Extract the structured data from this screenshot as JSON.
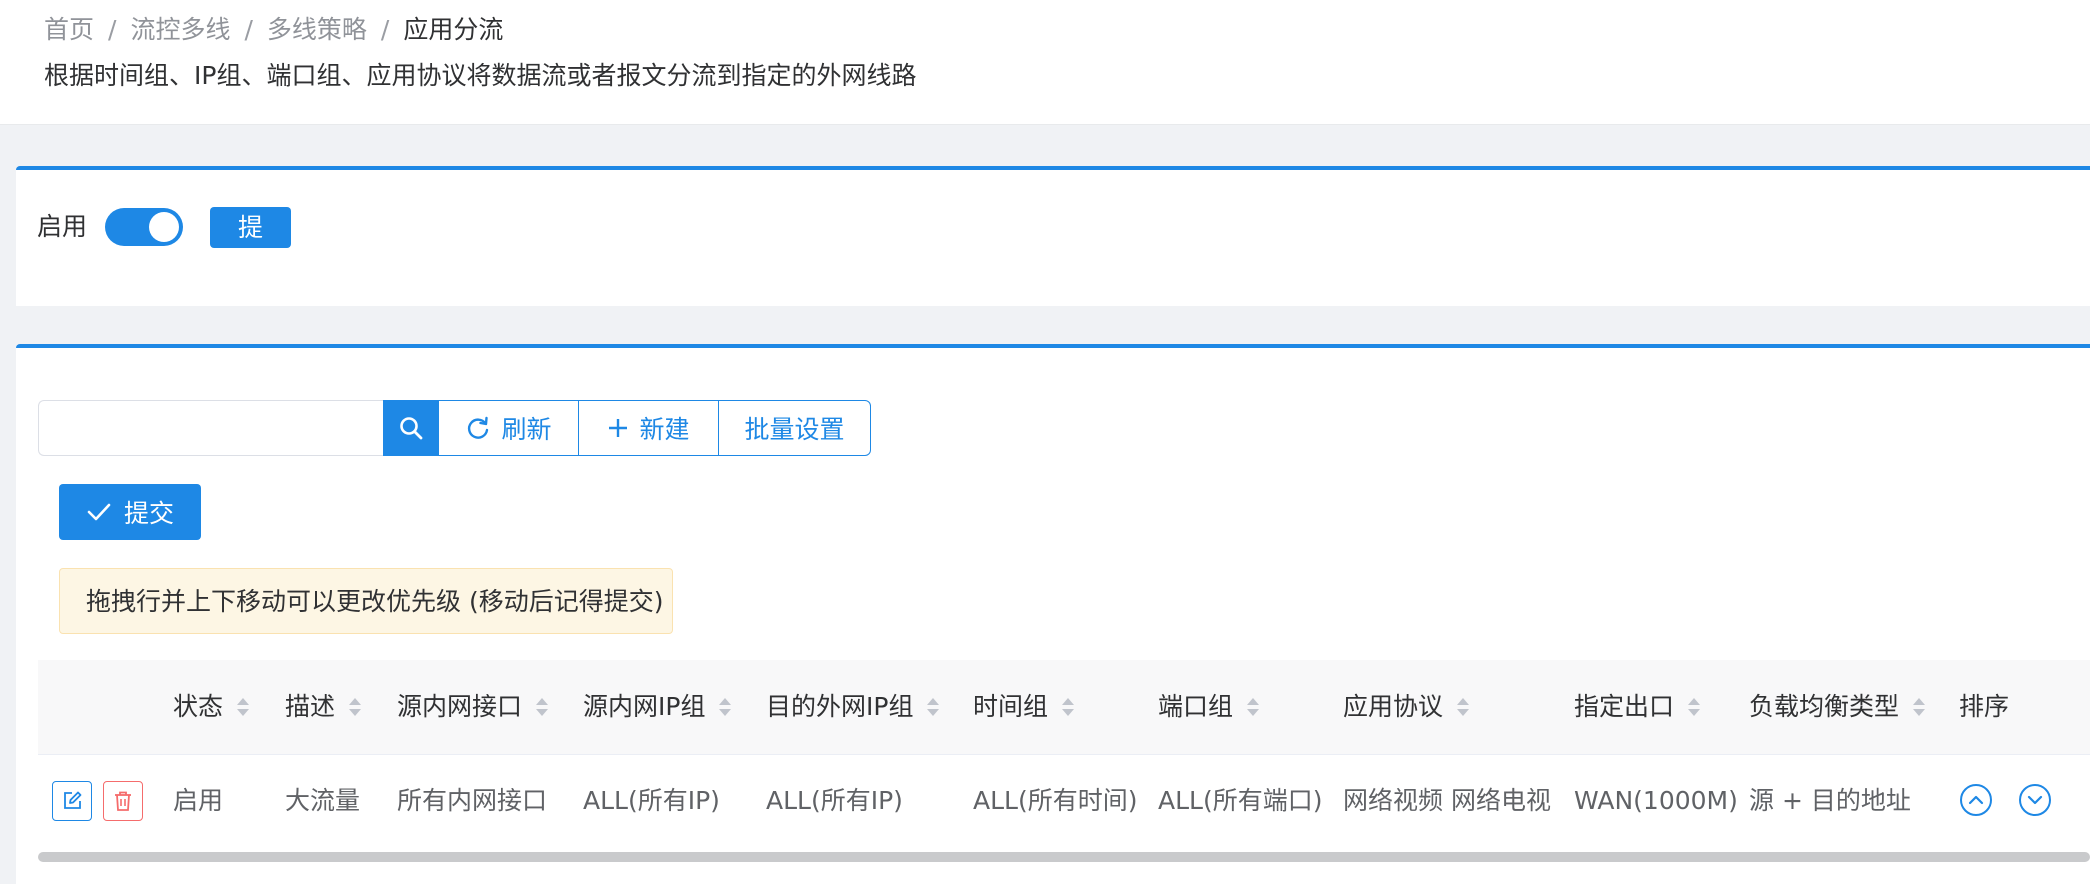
{
  "breadcrumb": [
    "首页",
    "流控多线",
    "多线策略",
    "应用分流"
  ],
  "breadcrumb_sep": "/",
  "description": "根据时间组、IP组、端口组、应用协议将数据流或者报文分流到指定的外网线路",
  "enable": {
    "label": "启用",
    "state": true,
    "submit_label": "提 交"
  },
  "toolbar": {
    "search_value": "",
    "refresh_label": "刷新",
    "new_label": "新建",
    "batch_label": "批量设置"
  },
  "submit_label": "提交",
  "alert_text": "拖拽行并上下移动可以更改优先级 (移动后记得提交)",
  "table": {
    "columns": [
      "状态",
      "描述",
      "源内网接口",
      "源内网IP组",
      "目的外网IP组",
      "时间组",
      "端口组",
      "应用协议",
      "指定出口",
      "负载均衡类型",
      "排序"
    ],
    "rows": [
      {
        "status": "启用",
        "desc": "大流量",
        "src_if": "所有内网接口",
        "src_ip": "ALL(所有IP)",
        "dst_ip": "ALL(所有IP)",
        "time": "ALL(所有时间)",
        "port": "ALL(所有端口)",
        "proto": "网络视频 网络电视",
        "out": "WAN(1000M)",
        "lb": "源 + 目的地址"
      }
    ]
  },
  "colors": {
    "primary": "#1e88e5",
    "danger": "#f56c6c",
    "warning_bg": "#fdf6e4"
  }
}
